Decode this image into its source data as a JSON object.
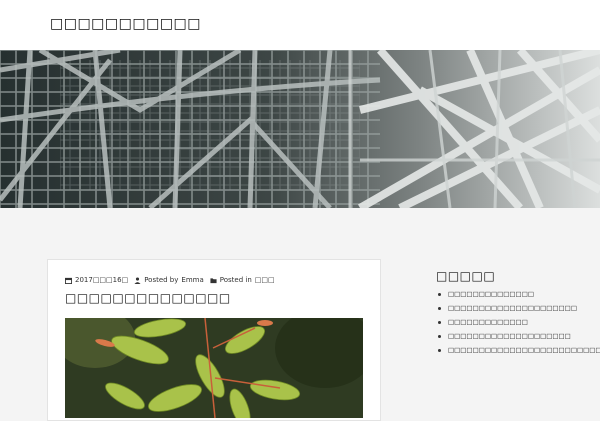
{
  "site": {
    "title": "□□□□□□□□□□□"
  },
  "post": {
    "date": "2017□□□16□",
    "author_label": "Posted by",
    "author": "Emma",
    "category_label": "Posted in",
    "category": "□□□",
    "title": "□□□□□□□□□□□□□□"
  },
  "sidebar": {
    "title": "□□□□□",
    "recent_posts": [
      {
        "label": "□□□□□□□□□□□□□□"
      },
      {
        "label": "□□□□□□□□□□□□□□□□□□□□□"
      },
      {
        "label": "□□□□□□□□□□□□□"
      },
      {
        "label": "□□□□□□□□□□□□□□□□□□□□"
      },
      {
        "label": "□□□□□□□□□□□□□□□□□□□□□□□□□"
      }
    ]
  },
  "icons": {
    "date": "calendar-icon",
    "author": "user-icon",
    "category": "folder-icon"
  },
  "colors": {
    "page_background": "#f4f4f4",
    "card_background": "#ffffff",
    "text": "#222222"
  }
}
